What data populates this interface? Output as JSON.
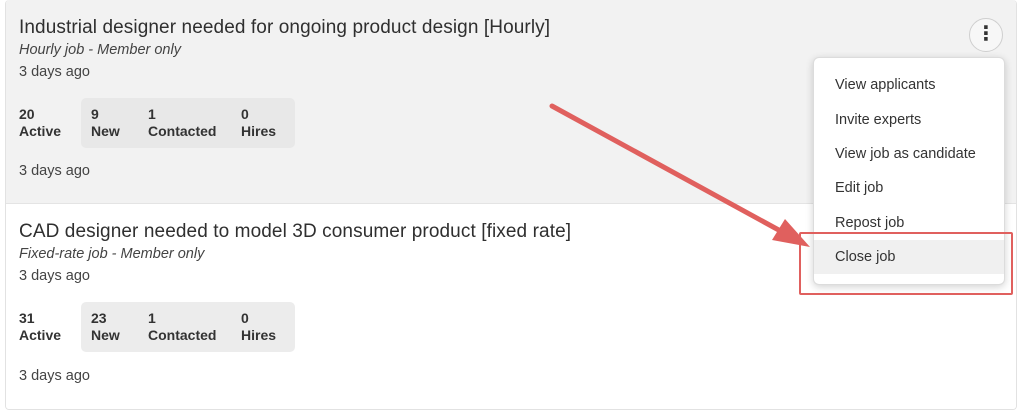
{
  "jobs": [
    {
      "title": "Industrial designer needed for ongoing product design [Hourly]",
      "type": "Hourly job - Member only",
      "age": "3 days ago",
      "stats": {
        "active": "20",
        "active_label": "Active",
        "new": "9",
        "new_label": "New",
        "contacted": "1",
        "contacted_label": "Contacted",
        "hires": "0",
        "hires_label": "Hires"
      },
      "footer_age": "3 days ago"
    },
    {
      "title": "CAD designer needed to model 3D consumer product [fixed rate]",
      "type": "Fixed-rate job - Member only",
      "age": "3 days ago",
      "stats": {
        "active": "31",
        "active_label": "Active",
        "new": "23",
        "new_label": "New",
        "contacted": "1",
        "contacted_label": "Contacted",
        "hires": "0",
        "hires_label": "Hires"
      },
      "footer_age": "3 days ago"
    }
  ],
  "menu": {
    "button_icon": "kebab-menu-icon",
    "items": [
      {
        "label": "View applicants"
      },
      {
        "label": "Invite experts"
      },
      {
        "label": "View job as candidate"
      },
      {
        "label": "Edit job"
      },
      {
        "label": "Repost job"
      },
      {
        "label": "Close job",
        "highlighted": true
      }
    ]
  },
  "annotation": {
    "color": "#e0605e",
    "icon": "arrow-icon"
  }
}
